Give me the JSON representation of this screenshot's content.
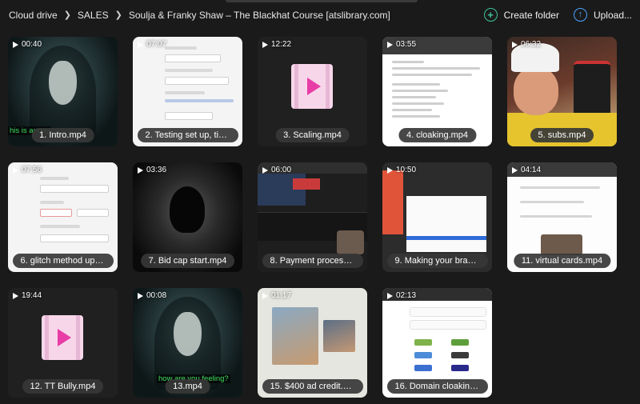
{
  "breadcrumb": {
    "items": [
      "Cloud drive",
      "SALES",
      "Soulja & Franky Shaw – The Blackhat Course [atslibrary.com]"
    ]
  },
  "actions": {
    "create_folder": "Create folder",
    "upload": "Upload..."
  },
  "files": [
    {
      "duration": "00:40",
      "name": "1. Intro.mp4",
      "subtitle": "his is anony"
    },
    {
      "duration": "07:07",
      "name": "2. Testing set up, tikto..."
    },
    {
      "duration": "12:22",
      "name": "3. Scaling.mp4"
    },
    {
      "duration": "03:55",
      "name": "4. cloaking.mp4"
    },
    {
      "duration": "06:32",
      "name": "5. subs.mp4"
    },
    {
      "duration": "07:56",
      "name": "6. glitch method upda..."
    },
    {
      "duration": "03:36",
      "name": "7. Bid cap start.mp4"
    },
    {
      "duration": "06:00",
      "name": "8. Payment processin..."
    },
    {
      "duration": "10:50",
      "name": "9. Making your brand ..."
    },
    {
      "duration": "04:14",
      "name": "11. virtual cards.mp4"
    },
    {
      "duration": "19:44",
      "name": "12. TT Bully.mp4"
    },
    {
      "duration": "00:08",
      "name": "13.mp4",
      "subtitle": "how are you feeling?"
    },
    {
      "duration": "01:17",
      "name": "15. $400 ad credit.mp4"
    },
    {
      "duration": "02:13",
      "name": "16. Domain cloaking...."
    }
  ],
  "colors": {
    "background": "#1a1a1a",
    "create_accent": "#3fc39a",
    "upload_accent": "#4aa3ff",
    "video_icon": "#e83ca6"
  },
  "icons": {
    "create_folder": "plus-circle-icon",
    "upload": "arrow-up-circle-icon",
    "duration": "play-triangle-icon",
    "placeholder": "video-file-icon"
  }
}
